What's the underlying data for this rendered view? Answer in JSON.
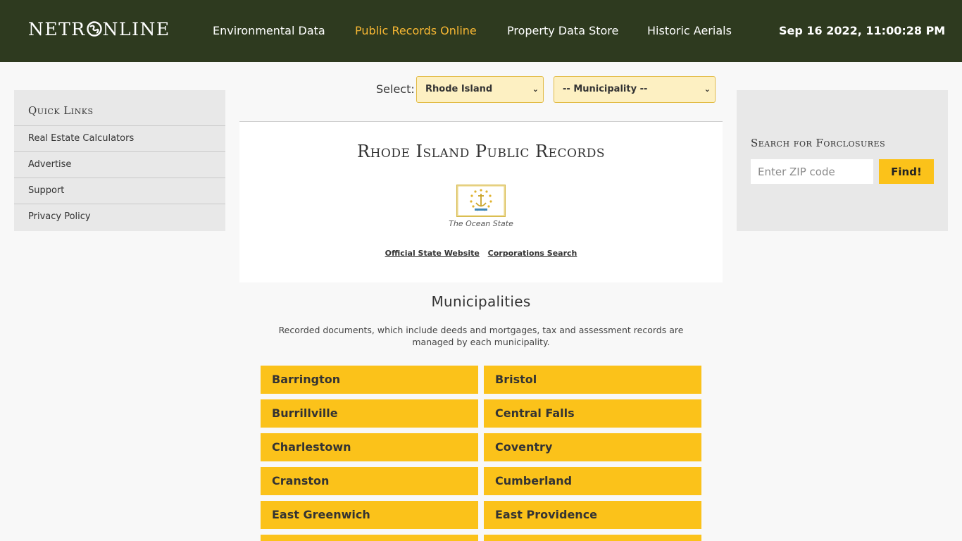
{
  "header": {
    "logo_left": "NETR",
    "logo_right": "NLINE",
    "nav": [
      {
        "label": "Environmental Data",
        "active": false
      },
      {
        "label": "Public Records Online",
        "active": true
      },
      {
        "label": "Property Data Store",
        "active": false
      },
      {
        "label": "Historic Aerials",
        "active": false
      }
    ],
    "datetime": "Sep 16 2022, 11:00:28 PM"
  },
  "quick_links": {
    "title": "Quick Links",
    "items": [
      "Real Estate Calculators",
      "Advertise",
      "Support",
      "Privacy Policy"
    ]
  },
  "foreclosure": {
    "title": "Search for Forclosures",
    "placeholder": "Enter ZIP code",
    "button": "Find!"
  },
  "selector": {
    "label": "Select:",
    "state": "Rhode Island",
    "municipality": "-- Municipality --"
  },
  "state_card": {
    "title": "Rhode Island Public Records",
    "nickname": "The Ocean State",
    "links": [
      "Official State Website",
      "Corporations Search"
    ]
  },
  "municipalities": {
    "title": "Municipalities",
    "description": "Recorded documents, which include deeds and mortgages, tax and assessment records are managed by each municipality.",
    "items": [
      "Barrington",
      "Bristol",
      "Burrillville",
      "Central Falls",
      "Charlestown",
      "Coventry",
      "Cranston",
      "Cumberland",
      "East Greenwich",
      "East Providence",
      "",
      ""
    ]
  },
  "colors": {
    "header_bg": "#2e3a1f",
    "accent": "#fbc21a",
    "nav_active": "#f7b733",
    "panel_bg": "#e8e8e8"
  }
}
